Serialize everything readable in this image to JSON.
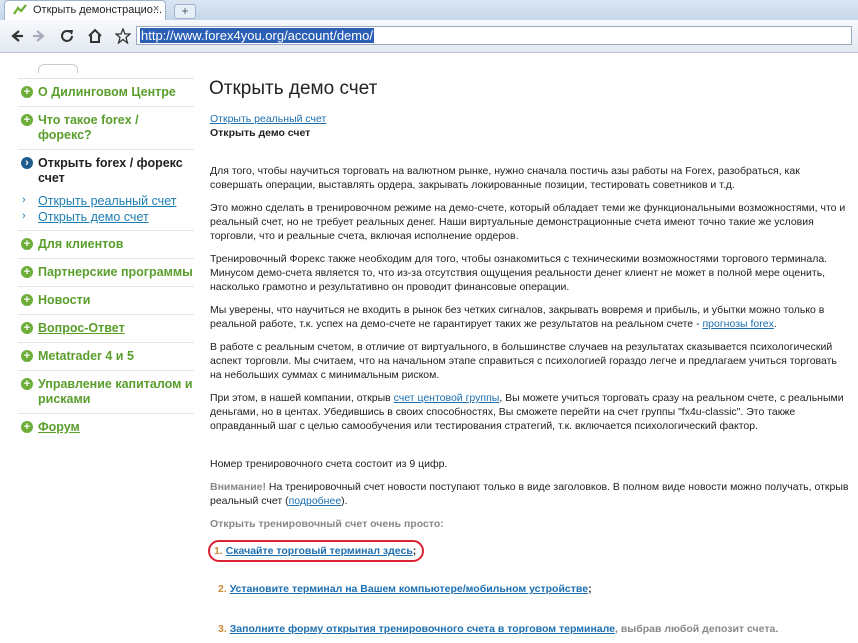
{
  "browser": {
    "tab_title": "Открыть демонстрацио...",
    "tab_close": "×",
    "new_tab": "+",
    "url": "http://www.forex4you.org/account/demo/",
    "icons": [
      "back-arrow-icon",
      "forward-arrow-icon",
      "reload-icon",
      "home-icon",
      "star-icon"
    ]
  },
  "sidebar": {
    "items": [
      {
        "label": "О Дилинговом Центре"
      },
      {
        "label": "Что такое forex / форекс?"
      },
      {
        "label": "Открыть forex / форекс счет"
      },
      {
        "label": "Для клиентов"
      },
      {
        "label": "Партнерские программы"
      },
      {
        "label": "Новости"
      },
      {
        "label": "Вопрос-Ответ"
      },
      {
        "label": "Metatrader 4 и 5"
      },
      {
        "label": "Управление капиталом и рисками"
      },
      {
        "label": "Форум"
      }
    ],
    "sub": [
      "Открыть реальный счет",
      "Открыть демо счет"
    ]
  },
  "main": {
    "title": "Открыть демо счет",
    "link_real": "Открыть реальный счет",
    "current": "Открыть демо счет",
    "p1": "Для того, чтобы научиться торговать на валютном рынке,  нужно сначала постичь азы работы на Forex, разобраться, как совершать операции, выставлять ордера, закрывать локированные позиции, тестировать советников и т.д.",
    "p2": "Это можно сделать в тренировочном режиме на демо-счете, который обладает теми же функциональными возможностями, что и реальный счет, но не требует реальных денег. Наши виртуальные демонстрационные счета имеют точно такие же условия торговли, что и реальные счета, включая исполнение ордеров.",
    "p3": "Тренировочный Форекс также необходим для того, чтобы ознакомиться с техническими возможностями торгового терминала. Минусом демо-счета является то, что из-за отсутствия ощущения реальности денег клиент не может в полной мере оценить, насколько грамотно и результативно он проводит финансовые операции.",
    "p4": "Мы уверены, что научиться не входить в рынок без четких сигналов, закрывать вовремя и прибыль, и убытки можно только в реальной работе, т.к. успех на демо-счете не гарантирует таких же результатов на реальном счете - ",
    "p4_link": "прогнозы forex",
    "p4_end": ".",
    "p5": "В работе с реальным счетом, в отличие от виртуального, в большинстве случаев на результатах сказывается психологический аспект торговли. Мы считаем, что на начальном этапе справиться с психологией гораздо легче и предлагаем учиться торговать на небольших суммах с минимальным риском.",
    "p6a": "При этом, в нашей компании, открыв ",
    "p6_link": "счет центовой группы",
    "p6b": ", Вы можете учиться торговать сразу на реальном счете, с реальными деньгами, но в центах. Убедившись в своих способностях, Вы сможете перейти на счет группы \"fx4u-classic\". Это также оправданный шаг с целью самообучения или тестирования стратегий, т.к. включается психологический фактор.",
    "digits": "Номер тренировочного счета состоит из 9 цифр.",
    "attention_label": "Внимание!",
    "attention_text": " На тренировочный счет новости поступают только в виде заголовков. В полном виде новости можно получать, открыв реальный счет (",
    "attention_link": "подробнее",
    "attention_end": ").",
    "simple": "Открыть тренировочный счет очень просто:",
    "steps": [
      {
        "num": "1.",
        "link": "Скачайте торговый терминал здесь",
        "tail": ";"
      },
      {
        "num": "2.",
        "link": "Установите терминал на Вашем компьютере/мобильном устройстве",
        "tail": ";"
      },
      {
        "num": "3.",
        "link": "Заполните форму открытия тренировочного счета в торговом терминале",
        "tail": ", выбрав любой депозит счета."
      }
    ]
  }
}
